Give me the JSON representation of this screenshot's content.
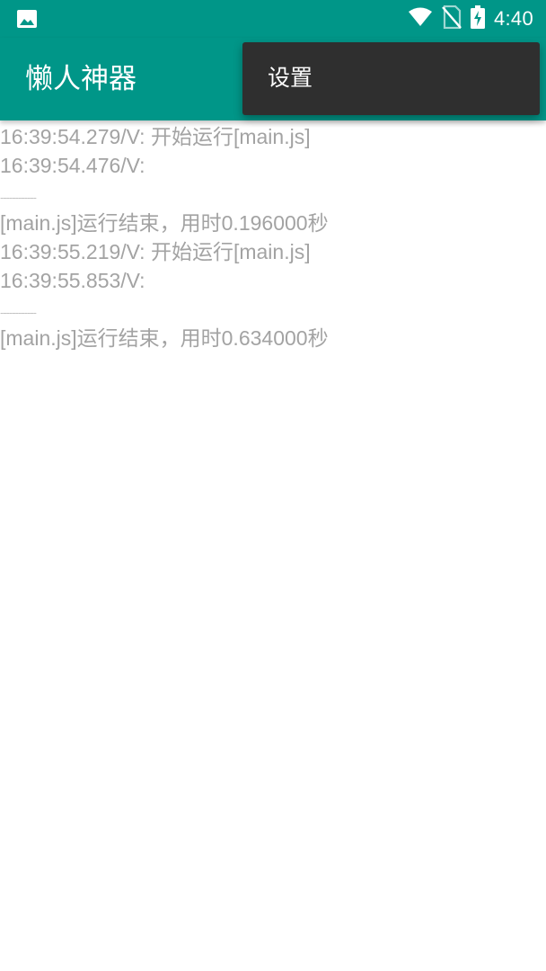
{
  "status_bar": {
    "time": "4:40",
    "icons": {
      "left": "image-notification-icon",
      "wifi": "wifi-icon",
      "sim": "no-sim-icon",
      "battery": "battery-charging-icon"
    }
  },
  "app_bar": {
    "title": "懒人神器",
    "color": "#009688"
  },
  "overflow_menu": {
    "items": [
      {
        "label": "设置"
      }
    ]
  },
  "log": {
    "lines": [
      {
        "kind": "text",
        "text": "16:39:54.279/V: 开始运行[main.js]"
      },
      {
        "kind": "text",
        "text": "16:39:54.476/V:"
      },
      {
        "kind": "separator",
        "text": "------------"
      },
      {
        "kind": "text",
        "text": "[main.js]运行结束，用时0.196000秒"
      },
      {
        "kind": "text",
        "text": "16:39:55.219/V: 开始运行[main.js]"
      },
      {
        "kind": "text",
        "text": "16:39:55.853/V:"
      },
      {
        "kind": "separator",
        "text": "------------"
      },
      {
        "kind": "text",
        "text": "[main.js]运行结束，用时0.634000秒"
      }
    ]
  }
}
